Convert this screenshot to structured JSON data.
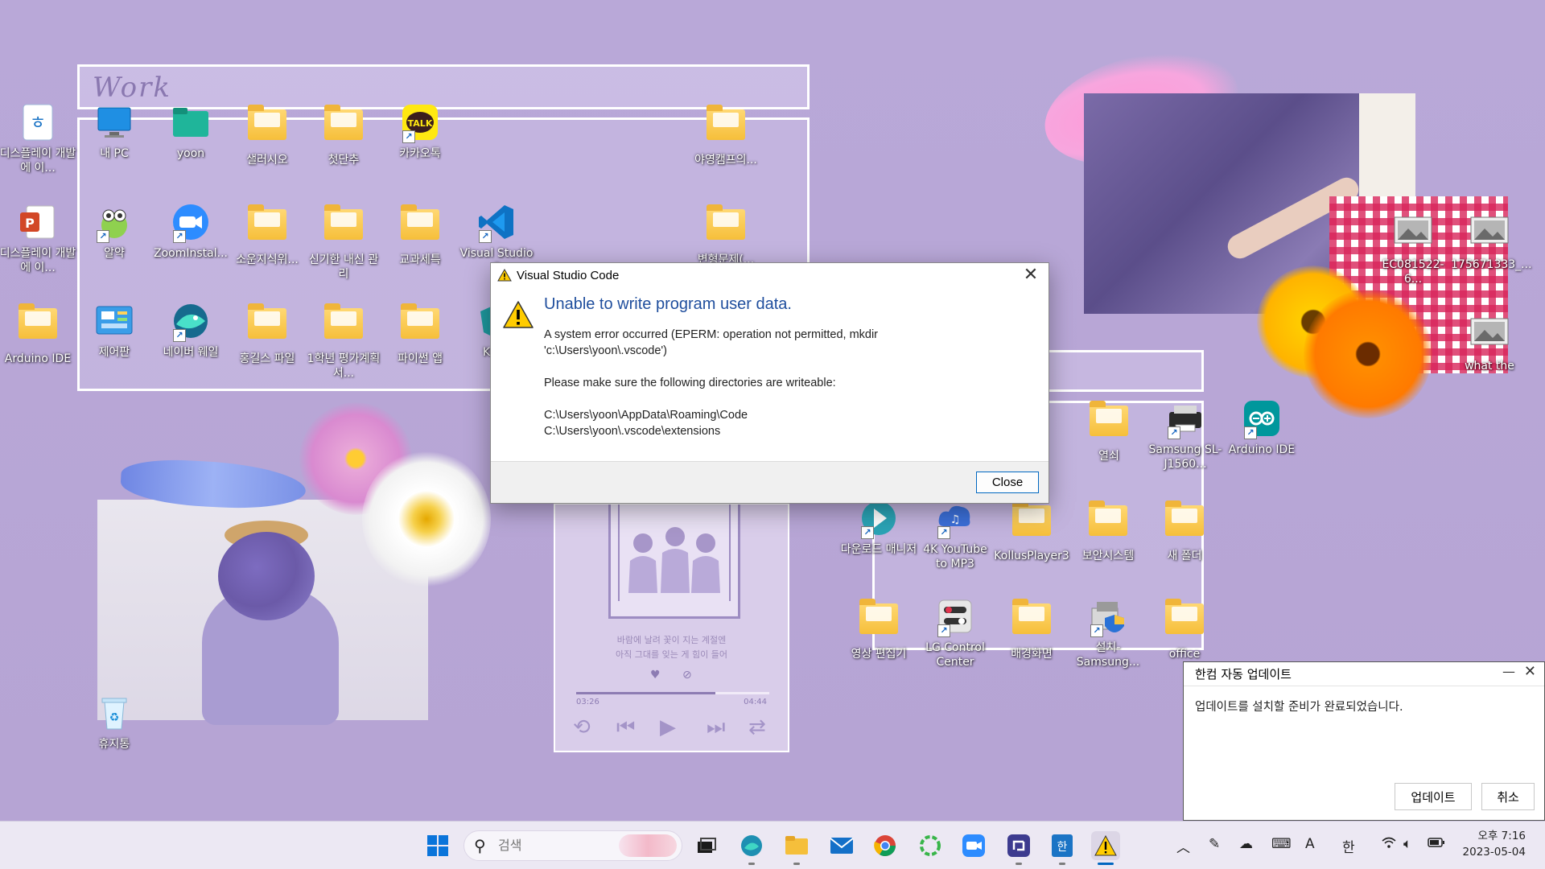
{
  "work_board": {
    "title": "Work"
  },
  "desktop_icons": [
    {
      "id": "display-dev-1",
      "label": "디스플레이 개발에 이...",
      "kind": "hwp"
    },
    {
      "id": "display-dev-2",
      "label": "디스플레이 개발에 이...",
      "kind": "ppt"
    },
    {
      "id": "arduino-left",
      "label": "Arduino IDE",
      "kind": "folder"
    },
    {
      "id": "my-pc",
      "label": "내 PC",
      "kind": "pc"
    },
    {
      "id": "yoon",
      "label": "yoon",
      "kind": "folder-teal"
    },
    {
      "id": "salary",
      "label": "샐러시오",
      "kind": "folder"
    },
    {
      "id": "first-child",
      "label": "첫단추",
      "kind": "folder"
    },
    {
      "id": "kakaotalk",
      "label": "카카오톡",
      "kind": "kakao"
    },
    {
      "id": "camp",
      "label": "야영캠프의...",
      "kind": "folder"
    },
    {
      "id": "dictionary",
      "label": "알약",
      "kind": "alyac"
    },
    {
      "id": "zoom-installer",
      "label": "ZoomInstal...",
      "kind": "zoom"
    },
    {
      "id": "sowon",
      "label": "소운지식위...",
      "kind": "folder"
    },
    {
      "id": "singihan",
      "label": "신기한 내신 관리",
      "kind": "folder"
    },
    {
      "id": "homework",
      "label": "교과세특",
      "kind": "folder"
    },
    {
      "id": "vscode",
      "label": "Visual Studio C",
      "kind": "vscode"
    },
    {
      "id": "transform",
      "label": "변형문제(...",
      "kind": "folder"
    },
    {
      "id": "control-panel",
      "label": "제어판",
      "kind": "control"
    },
    {
      "id": "naver-whale",
      "label": "네이버 웨일",
      "kind": "whale"
    },
    {
      "id": "hongdong",
      "label": "홍길스 파일",
      "kind": "folder"
    },
    {
      "id": "first-year",
      "label": "1학년 평가계획서...",
      "kind": "folder"
    },
    {
      "id": "python-app",
      "label": "파이썬 앱",
      "kind": "folder"
    },
    {
      "id": "kcast",
      "label": "KCas",
      "kind": "kcast"
    },
    {
      "id": "yeolsae",
      "label": "열쇠",
      "kind": "folder"
    },
    {
      "id": "samsung-printer",
      "label": "Samsung SL-J1560...",
      "kind": "printer"
    },
    {
      "id": "arduino-right",
      "label": "Arduino IDE",
      "kind": "arduino"
    },
    {
      "id": "download-mgr",
      "label": "다운로드 매니저",
      "kind": "download"
    },
    {
      "id": "yt-mp3",
      "label": "4K YouTube to MP3",
      "kind": "ytmp3"
    },
    {
      "id": "kollus",
      "label": "KollusPlayer3",
      "kind": "folder"
    },
    {
      "id": "security",
      "label": "보안시스템",
      "kind": "folder"
    },
    {
      "id": "new-folder",
      "label": "새 폴더",
      "kind": "folder"
    },
    {
      "id": "video-edit",
      "label": "영상 편집기",
      "kind": "folder"
    },
    {
      "id": "lg-control",
      "label": "LG Control Center",
      "kind": "lg"
    },
    {
      "id": "wallpaper",
      "label": "배경화면",
      "kind": "folder"
    },
    {
      "id": "install-samsung",
      "label": "설치-Samsung...",
      "kind": "install"
    },
    {
      "id": "office",
      "label": "office",
      "kind": "folder"
    },
    {
      "id": "ec081522",
      "label": "EC081522-6...",
      "kind": "photo"
    },
    {
      "id": "p175671333",
      "label": "175671333_...",
      "kind": "photo"
    },
    {
      "id": "what-the",
      "label": "what the",
      "kind": "photo"
    },
    {
      "id": "recycle-bin",
      "label": "휴지통",
      "kind": "recycle"
    }
  ],
  "music_widget": {
    "line1": "바람에 날려 꽃이 지는 계절엔",
    "line2": "아직 그대를 잊는 게 힘이 들어",
    "elapsed": "03:26",
    "total": "04:44",
    "progress": 0.72
  },
  "dialog": {
    "title": "Visual Studio Code",
    "heading": "Unable to write program user data.",
    "message_1": "A system error occurred (EPERM: operation not permitted, mkdir 'c:\\Users\\yoon\\.vscode')",
    "message_2": "Please make sure the following directories are writeable:",
    "path_1": "C:\\Users\\yoon\\AppData\\Roaming\\Code",
    "path_2": "C:\\Users\\yoon\\.vscode\\extensions",
    "close_label": "Close"
  },
  "hancom_update": {
    "title": "한컴 자동 업데이트",
    "message": "업데이트를 설치할 준비가 완료되었습니다.",
    "update_label": "업데이트",
    "cancel_label": "취소"
  },
  "taskbar": {
    "search_placeholder": "검색",
    "tray_ime_a": "A",
    "tray_ime_han": "한",
    "time": "오후 7:16",
    "date": "2023-05-04"
  },
  "colors": {
    "desktop_bg": "#b8a7d6",
    "dialog_heading": "#1f4e9d",
    "accent_blue": "#0067c0",
    "warning_yellow": "#ffcc00"
  }
}
